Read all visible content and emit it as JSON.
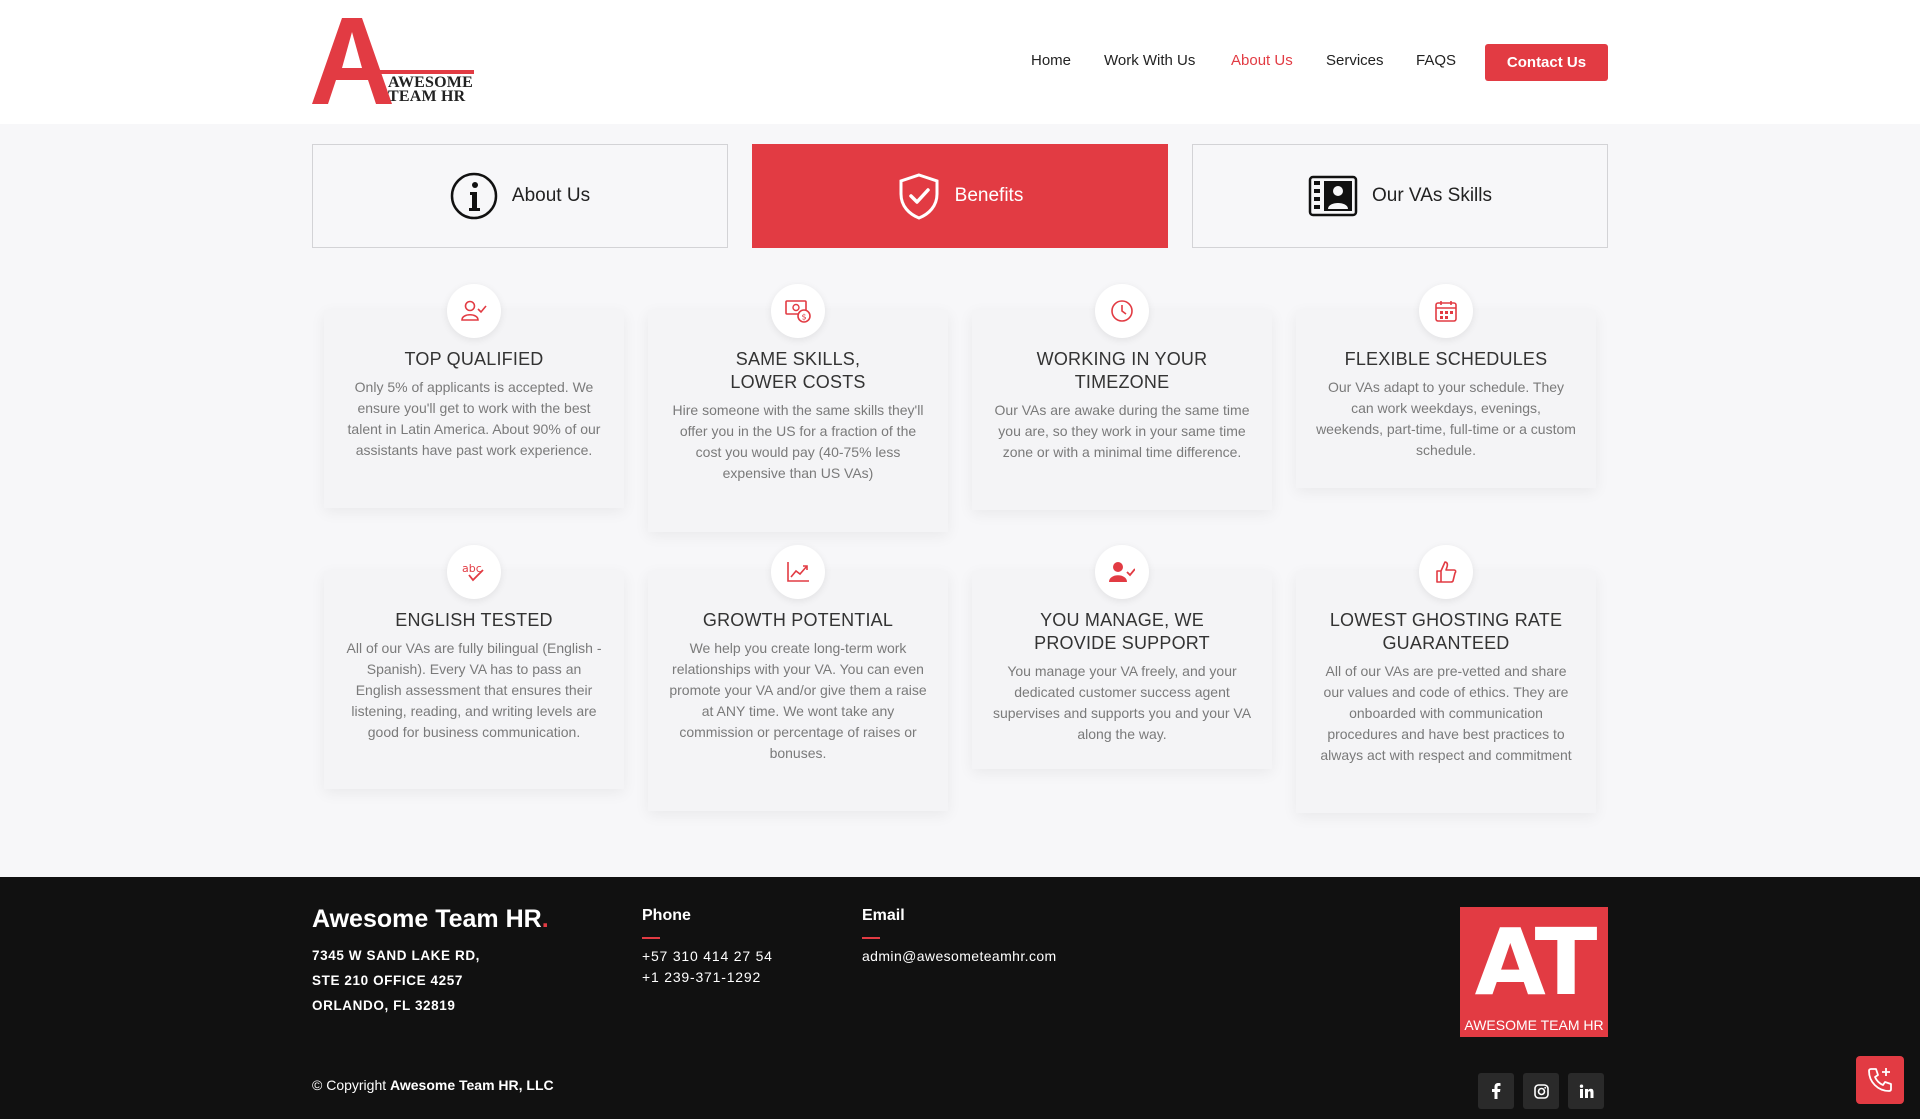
{
  "header": {
    "logo_line1": "AWESOME",
    "logo_line2": "TEAM HR",
    "nav": [
      "Home",
      "Work With Us",
      "About Us",
      "Services",
      "FAQS"
    ],
    "active_nav": "About Us",
    "cta_label": "Contact Us"
  },
  "tabs": [
    {
      "label": "About Us",
      "icon": "info-icon"
    },
    {
      "label": "Benefits",
      "icon": "shield-check-icon",
      "active": true
    },
    {
      "label": "Our VAs Skills",
      "icon": "id-card-icon"
    }
  ],
  "cards": [
    {
      "title": "TOP QUALIFIED",
      "icon": "user-check-icon",
      "text": "Only 5% of applicants is accepted. We ensure you'll get to work with the best talent in Latin America. About 90% of our assistants have past work experience."
    },
    {
      "title_line1": "SAME SKILLS,",
      "title_line2": "LOWER COSTS",
      "icon": "money-icon",
      "text": "Hire someone with the same skills they'll offer you in the US for a fraction of the cost you would pay (40-75% less expensive than US VAs)"
    },
    {
      "title_line1": "WORKING IN YOUR",
      "title_line2": "TIMEZONE",
      "icon": "clock-icon",
      "text": "Our VAs are awake during the same time you are, so they work in your same time zone or with a minimal time difference."
    },
    {
      "title": "FLEXIBLE SCHEDULES",
      "icon": "calendar-icon",
      "text": "Our VAs adapt to your schedule. They can work weekdays, evenings, weekends, part-time, full-time or a custom schedule."
    },
    {
      "title": "ENGLISH TESTED",
      "icon": "abc-check-icon",
      "text": "All of our VAs are fully bilingual (English - Spanish). Every VA has to pass an English assessment that ensures their listening, reading, and writing levels are good for business communication."
    },
    {
      "title": "GROWTH POTENTIAL",
      "icon": "chart-up-icon",
      "text": "We help you create long-term work relationships with your VA. You can even promote your VA and/or give them a raise at ANY time. We wont take any commission or percentage of raises or bonuses."
    },
    {
      "title_line1": "YOU MANAGE, WE",
      "title_line2": "PROVIDE SUPPORT",
      "icon": "user-support-icon",
      "text": "You manage your VA freely, and your dedicated customer success agent supervises and supports you and your VA along the way."
    },
    {
      "title_line1": "LOWEST GHOSTING RATE",
      "title_line2": "GUARANTEED",
      "icon": "thumbs-up-icon",
      "text": "All of our VAs are pre-vetted and share our values and code of ethics. They are onboarded with communication procedures and have best practices to always act with respect and commitment"
    }
  ],
  "footer": {
    "brand": "Awesome Team HR",
    "brand_dot": ".",
    "address": [
      "7345 W SAND LAKE RD,",
      "STE 210 OFFICE 4257",
      "ORLANDO, FL 32819"
    ],
    "phone_heading": "Phone",
    "phones": [
      "+57 310 414 27 54",
      "+1 239-371-1292"
    ],
    "email_heading": "Email",
    "email": "admin@awesometeamhr.com",
    "logo_big": "AT",
    "logo_small": "AWESOME TEAM HR",
    "copyright_prefix": "© Copyright",
    "copyright_owner": "Awesome Team HR, LLC",
    "social": [
      "f",
      "ig",
      "in"
    ]
  },
  "colors": {
    "accent": "#e23b43",
    "footer_bg": "#111111",
    "page_bg": "#f7f7f9"
  }
}
